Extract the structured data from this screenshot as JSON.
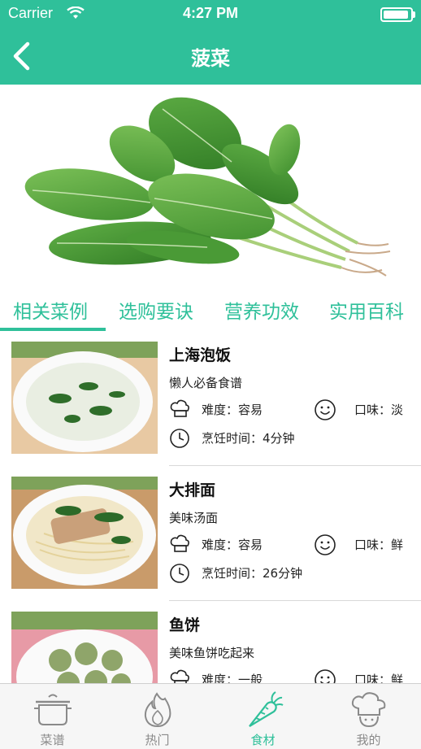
{
  "status": {
    "carrier": "Carrier",
    "time": "4:27 PM",
    "battery_level": 1.0
  },
  "nav": {
    "title": "菠菜",
    "back_icon": "chevron-left-icon"
  },
  "colors": {
    "accent": "#2fc09a",
    "inactive": "#8a8a8a"
  },
  "tabs": [
    {
      "label": "相关菜例",
      "active": true
    },
    {
      "label": "选购要诀",
      "active": false
    },
    {
      "label": "营养功效",
      "active": false
    },
    {
      "label": "实用百科",
      "active": false
    }
  ],
  "recipes": [
    {
      "name": "上海泡饭",
      "desc": "懒人必备食谱",
      "difficulty": "难度：容易",
      "taste": "口味：淡",
      "time": "烹饪时间：4分钟"
    },
    {
      "name": "大排面",
      "desc": "美味汤面",
      "difficulty": "难度：容易",
      "taste": "口味：鲜",
      "time": "烹饪时间：26分钟"
    },
    {
      "name": "鱼饼",
      "desc": "美味鱼饼吃起来",
      "difficulty": "难度：一般",
      "taste": "口味：鲜",
      "time": ""
    }
  ],
  "tabbar": [
    {
      "label": "菜谱",
      "icon": "pot-icon",
      "active": false
    },
    {
      "label": "热门",
      "icon": "flame-icon",
      "active": false
    },
    {
      "label": "食材",
      "icon": "carrot-icon",
      "active": true
    },
    {
      "label": "我的",
      "icon": "chef-hat-icon",
      "active": false
    }
  ]
}
